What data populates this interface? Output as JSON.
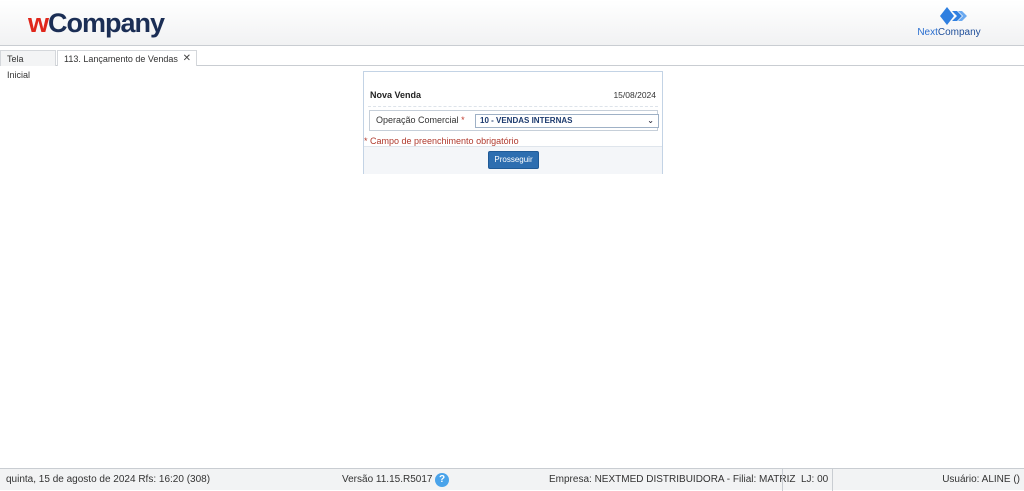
{
  "header": {
    "logo_w": "w",
    "logo_rest": "Company",
    "partner_logo_prefix": "Next",
    "partner_logo_suffix": "Company"
  },
  "tabs": [
    {
      "label": "Tela Inicial"
    },
    {
      "label": "113. Lançamento de Vendas",
      "close": "✕"
    }
  ],
  "form": {
    "title": "Nova Venda",
    "date": "15/08/2024",
    "field_label": "Operação Comercial",
    "required_mark": "*",
    "field_value": "10 - VENDAS INTERNAS",
    "required_note": "* Campo de preenchimento obrigatório",
    "submit_label": "Prosseguir"
  },
  "status_bar": {
    "date_text": "quinta, 15 de agosto de 2024  Rfs: 16:20 (308)",
    "version": "Versão 11.15.R5017",
    "help": "?",
    "empresa": "Empresa: NEXTMED DISTRIBUIDORA - Filial: MATRIZ",
    "lj": "LJ: 00",
    "user": "Usuário: ALINE ()"
  }
}
